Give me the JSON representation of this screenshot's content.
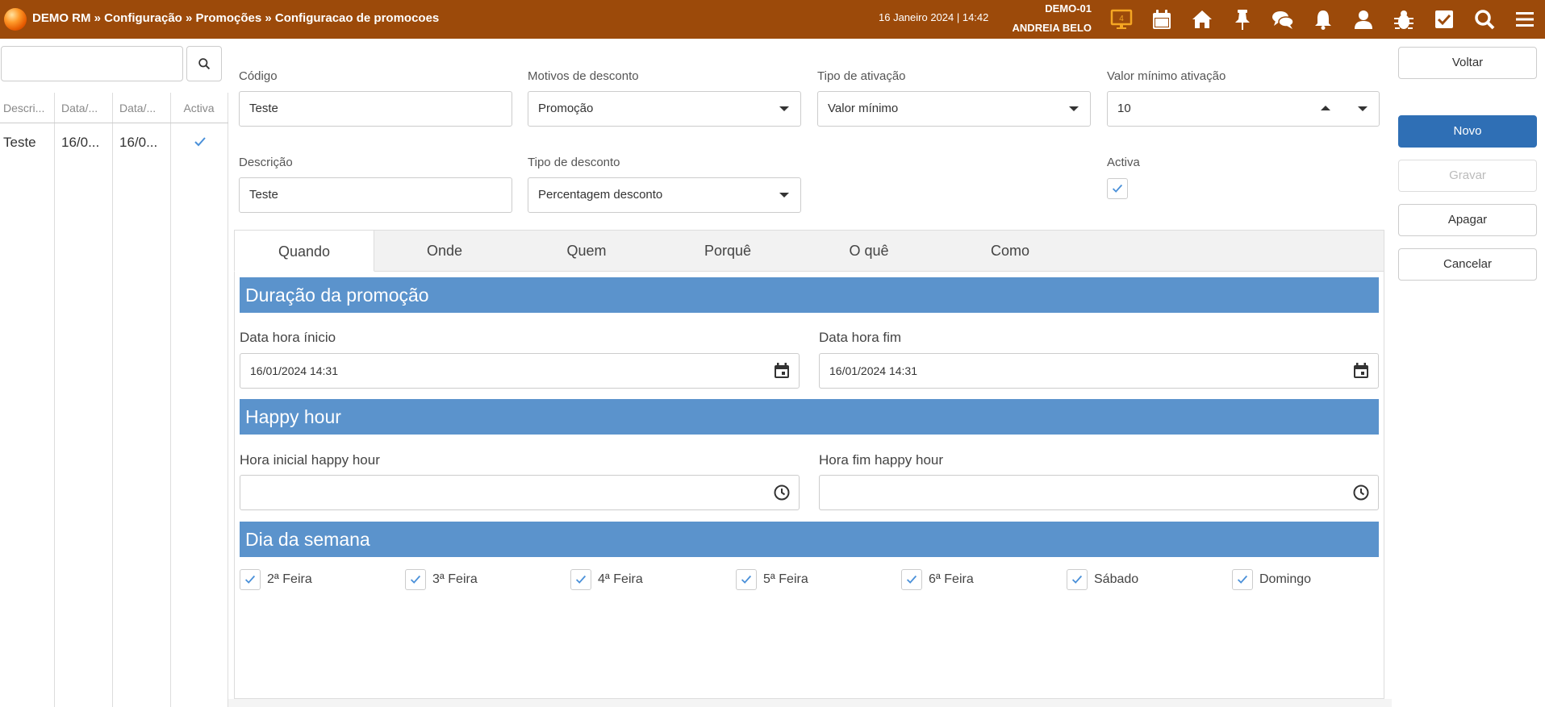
{
  "header": {
    "breadcrumb": "DEMO RM » Configuração » Promoções » Configuracao de promocoes",
    "datetime": "16 Janeiro 2024 | 14:42",
    "company": "DEMO-01",
    "user": "ANDREIA BELO",
    "monitor_badge": "4",
    "icons": [
      "monitor-icon",
      "calendar-icon",
      "home-icon",
      "pin-icon",
      "chat-icon",
      "bell-icon",
      "user-icon",
      "bug-icon",
      "checkbox-icon",
      "search-icon",
      "menu-icon"
    ]
  },
  "list": {
    "search_value": "",
    "columns": [
      "Descri...",
      "Data/...",
      "Data/...",
      "Activa"
    ],
    "rows": [
      {
        "descricao": "Teste",
        "data1": "16/0...",
        "data2": "16/0...",
        "activa": true
      }
    ]
  },
  "form": {
    "codigo": {
      "label": "Código",
      "value": "Teste"
    },
    "motivos": {
      "label": "Motivos de desconto",
      "value": "Promoção"
    },
    "tipo_ativacao": {
      "label": "Tipo de ativação",
      "value": "Valor mínimo"
    },
    "valor_minimo": {
      "label": "Valor mínimo ativação",
      "value": "10"
    },
    "descricao": {
      "label": "Descrição",
      "value": "Teste"
    },
    "tipo_desconto": {
      "label": "Tipo de desconto",
      "value": "Percentagem desconto"
    },
    "activa": {
      "label": "Activa",
      "checked": true
    }
  },
  "actions": {
    "voltar": "Voltar",
    "novo": "Novo",
    "gravar": "Gravar",
    "apagar": "Apagar",
    "cancelar": "Cancelar"
  },
  "tabs": [
    "Quando",
    "Onde",
    "Quem",
    "Porquê",
    "O quê",
    "Como"
  ],
  "active_tab": "Quando",
  "quando": {
    "duracao_title": "Duração da promoção",
    "inicio_label": "Data hora ínicio",
    "inicio_value": "16/01/2024 14:31",
    "fim_label": "Data hora fim",
    "fim_value": "16/01/2024 14:31",
    "happy_title": "Happy hour",
    "happy_inicio_label": "Hora inicial happy hour",
    "happy_inicio_value": "",
    "happy_fim_label": "Hora fim happy hour",
    "happy_fim_value": "",
    "dias_title": "Dia da semana",
    "dias": [
      {
        "label": "2ª Feira",
        "checked": true
      },
      {
        "label": "3ª Feira",
        "checked": true
      },
      {
        "label": "4ª Feira",
        "checked": true
      },
      {
        "label": "5ª Feira",
        "checked": true
      },
      {
        "label": "6ª Feira",
        "checked": true
      },
      {
        "label": "Sábado",
        "checked": true
      },
      {
        "label": "Domingo",
        "checked": true
      }
    ]
  },
  "colors": {
    "topbar": "#9c4a0a",
    "section": "#5b93cc",
    "primary_button": "#2f6fb5",
    "check": "#4a90d9",
    "monitor_icon": "#f5a623"
  }
}
